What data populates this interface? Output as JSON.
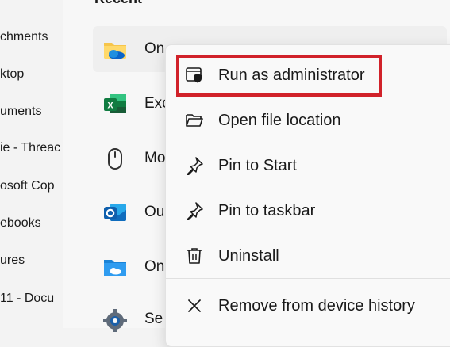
{
  "left_pane": {
    "items": [
      {
        "label": "chments"
      },
      {
        "label": "ktop"
      },
      {
        "label": "uments"
      },
      {
        "label": "ie - Threac"
      },
      {
        "label": "osoft Cop"
      },
      {
        "label": "ebooks"
      },
      {
        "label": "ures"
      },
      {
        "label": "11 - Docu"
      }
    ]
  },
  "recent": {
    "title": "Recent",
    "apps": [
      {
        "label": "On",
        "icon": "onedrive-folder-icon"
      },
      {
        "label": "Exc",
        "icon": "excel-icon"
      },
      {
        "label": "Mo",
        "icon": "mouse-icon"
      },
      {
        "label": "Ou",
        "icon": "outlook-icon"
      },
      {
        "label": "On",
        "icon": "onedrive-folder-icon"
      },
      {
        "label": "Se",
        "icon": "settings-gear-icon"
      }
    ]
  },
  "context_menu": {
    "items": [
      {
        "label": "Run as administrator",
        "icon": "shield-window-icon"
      },
      {
        "label": "Open file location",
        "icon": "folder-open-icon"
      },
      {
        "label": "Pin to Start",
        "icon": "pin-icon"
      },
      {
        "label": "Pin to taskbar",
        "icon": "pin-icon"
      },
      {
        "label": "Uninstall",
        "icon": "trash-icon"
      },
      {
        "label": "Remove from device history",
        "icon": "close-icon"
      }
    ]
  },
  "colors": {
    "highlight": "#d1222a",
    "excel_green": "#1f7244",
    "outlook_blue": "#0f6cbd",
    "onedrive_blue": "#0a64c9"
  }
}
